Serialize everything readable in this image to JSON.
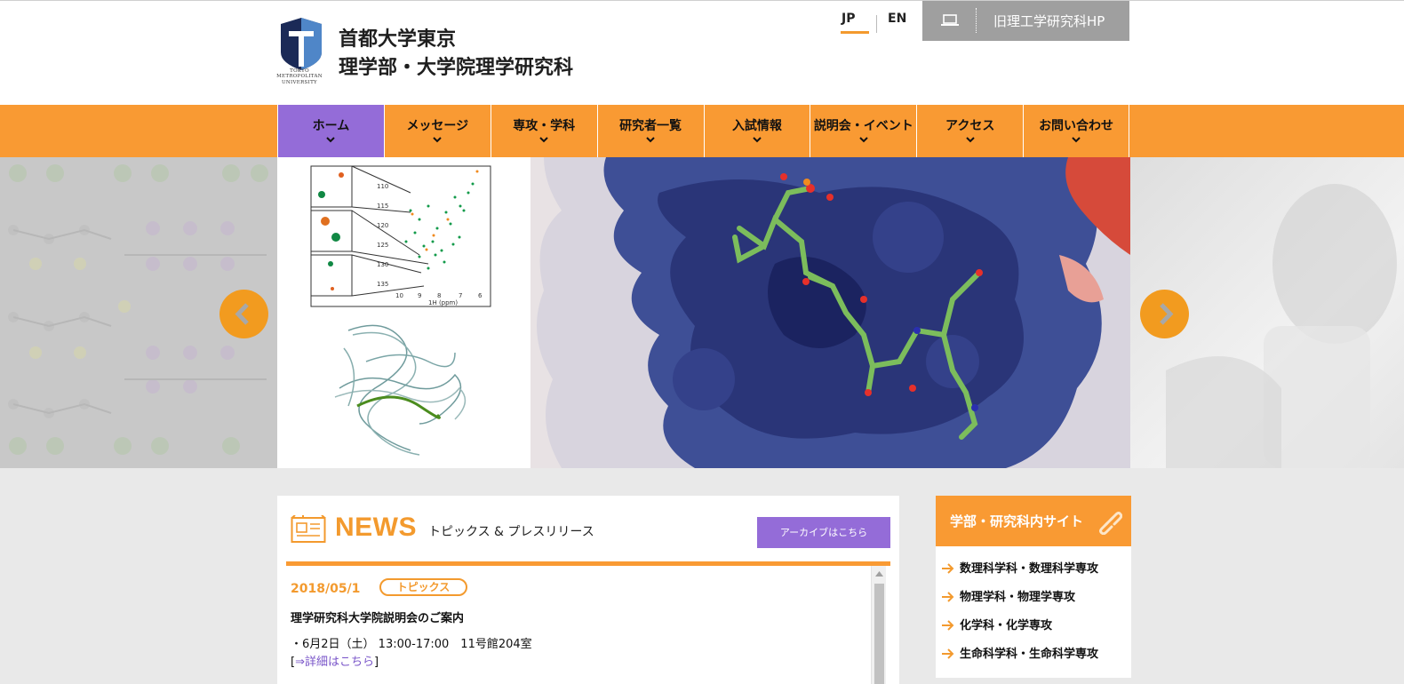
{
  "header": {
    "logo_line1": "TOKYO",
    "logo_line2": "METROPOLITAN",
    "logo_line3": "UNIVERSITY",
    "title_line1": "首都大学東京",
    "title_line2": "理学部・大学院理学研究科",
    "lang_jp": "JP",
    "lang_en": "EN",
    "old_site_label": "旧理工学研究科HP"
  },
  "nav": {
    "items": [
      {
        "label": "ホーム"
      },
      {
        "label": "メッセージ"
      },
      {
        "label": "専攻・学科"
      },
      {
        "label": "研究者一覧"
      },
      {
        "label": "入試情報"
      },
      {
        "label": "説明会・イベント"
      },
      {
        "label": "アクセス"
      },
      {
        "label": "お問い合わせ"
      }
    ]
  },
  "hero": {
    "nmr_ticks_y": [
      "110",
      "115",
      "120",
      "125",
      "130",
      "135"
    ],
    "nmr_ticks_x": [
      "10",
      "9",
      "8",
      "7",
      "6"
    ],
    "nmr_axis_label": "1H (ppm)"
  },
  "news": {
    "title": "NEWS",
    "subtitle": "トピックス & プレスリリース",
    "archive_label": "アーカイブはこちら",
    "items": [
      {
        "date": "2018/05/1",
        "badge": "トピックス",
        "headline": "理学研究科大学院説明会のご案内",
        "body": "・6月2日（土） 13:00-17:00　11号館204室",
        "link_text": "⇒詳細はこちら"
      }
    ]
  },
  "sites": {
    "title": "学部・研究科内サイト",
    "items": [
      {
        "label": "数理科学科・数理科学専攻"
      },
      {
        "label": "物理学科・物理学専攻"
      },
      {
        "label": "化学科・化学専攻"
      },
      {
        "label": "生命科学科・生命科学専攻"
      }
    ]
  },
  "colors": {
    "accent_orange": "#f99a33",
    "accent_purple": "#946cd8",
    "gray_button": "#9f9f9f"
  }
}
